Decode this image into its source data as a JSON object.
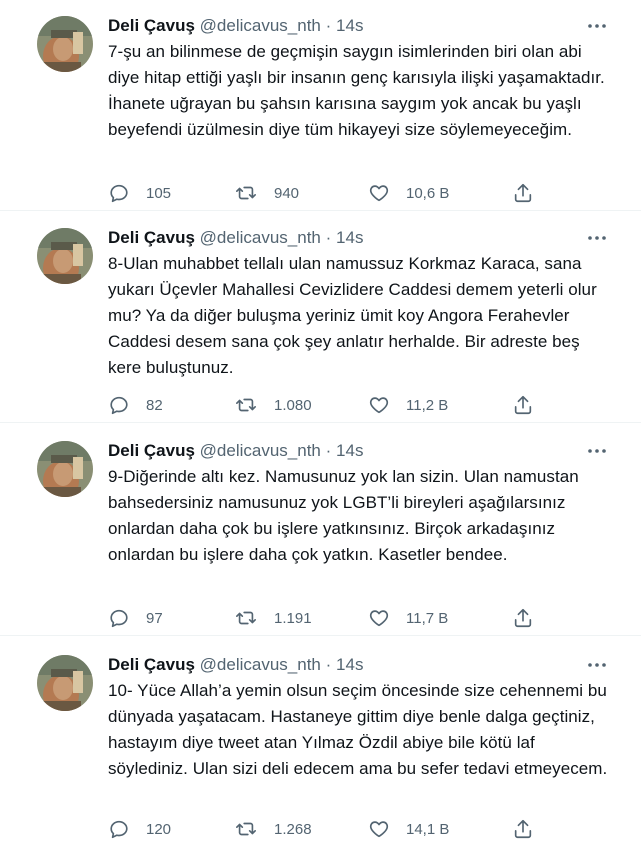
{
  "tweets": [
    {
      "name": "Deli Çavuş",
      "handle": "@delicavus_nth",
      "dot": "·",
      "time": "14s",
      "text": "7-şu an bilinmese de geçmişin saygın isimlerinden biri olan abi diye hitap ettiği yaşlı bir insanın genç karısıyla ilişki yaşamaktadır. İhanete uğrayan bu şahsın karısına saygım yok ancak bu yaşlı beyefendi üzülmesin diye tüm hikayeyi size söylemeyeceğim.",
      "replies": "105",
      "retweets": "940",
      "likes": "10,6 B"
    },
    {
      "name": "Deli Çavuş",
      "handle": "@delicavus_nth",
      "dot": "·",
      "time": "14s",
      "text": "8-Ulan muhabbet tellalı ulan namussuz Korkmaz Karaca, sana yukarı Üçevler Mahallesi Cevizlidere Caddesi demem yeterli olur mu? Ya da diğer buluşma yeriniz ümit koy Angora Ferahevler Caddesi desem sana çok şey anlatır herhalde. Bir adreste beş kere buluştunuz.",
      "replies": "82",
      "retweets": "1.080",
      "likes": "11,2 B"
    },
    {
      "name": "Deli Çavuş",
      "handle": "@delicavus_nth",
      "dot": "·",
      "time": "14s",
      "text": "9-Diğerinde altı kez. Namusunuz yok lan sizin. Ulan namustan bahsedersiniz namusunuz yok LGBT’li bireyleri aşağılarsınız onlardan daha çok bu işlere yatkınsınız. Birçok arkadaşınız onlardan bu işlere daha çok yatkın. Kasetler bendee.",
      "replies": "97",
      "retweets": "1.191",
      "likes": "11,7 B"
    },
    {
      "name": "Deli Çavuş",
      "handle": "@delicavus_nth",
      "dot": "·",
      "time": "14s",
      "text": "10- Yüce Allah’a yemin olsun seçim öncesinde size cehennemi bu dünyada yaşatacam. Hastaneye gittim diye benle dalga geçtiniz, hastayım diye tweet atan Yılmaz Özdil abiye bile kötü laf söylediniz. Ulan sizi deli edecem ama bu sefer tedavi etmeyecem.",
      "replies": "120",
      "retweets": "1.268",
      "likes": "14,1 B"
    }
  ],
  "icons": {
    "reply": "reply-icon",
    "retweet": "retweet-icon",
    "like": "heart-icon",
    "share": "share-icon",
    "more": "more-icon"
  },
  "colors": {
    "text": "#0f1419",
    "secondary": "#536471",
    "divider": "#eff3f4"
  }
}
